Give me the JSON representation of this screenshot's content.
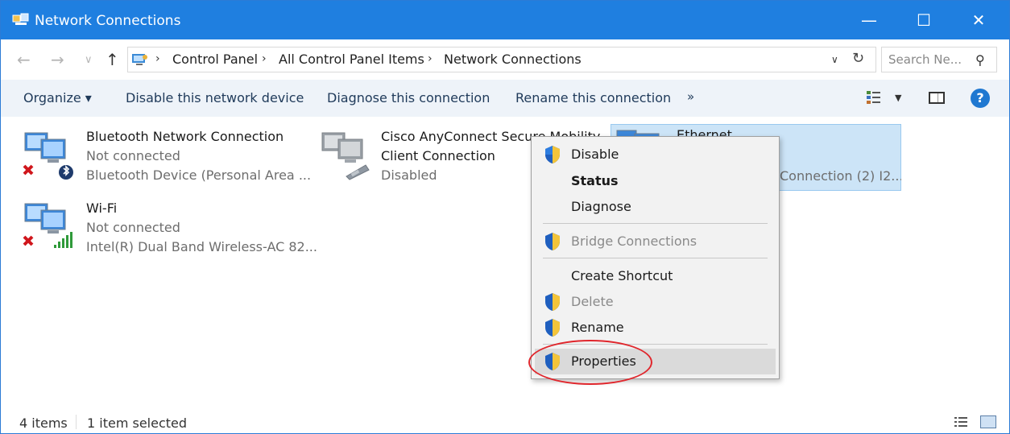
{
  "window": {
    "title": "Network Connections",
    "controls": {
      "minimize": "—",
      "maximize": "☐",
      "close": "✕"
    }
  },
  "address": {
    "back_icon": "←",
    "forward_icon": "→",
    "history_icon": "∨",
    "up_icon": "↑",
    "separator": "›",
    "breadcrumbs": [
      "Control Panel",
      "All Control Panel Items",
      "Network Connections"
    ],
    "dropdown_icon": "∨",
    "refresh_icon": "↻",
    "search_placeholder": "Search Ne...",
    "search_icon": "⚲"
  },
  "toolbar": {
    "organize": "Organize ▾",
    "disable": "Disable this network device",
    "diagnose": "Diagnose this connection",
    "rename": "Rename this connection",
    "more": "»",
    "view_dropdown": "▼",
    "help": "?"
  },
  "items": [
    {
      "name": "Bluetooth Network Connection",
      "status": "Not connected",
      "device": "Bluetooth Device (Personal Area ..."
    },
    {
      "name": "Cisco AnyConnect Secure Mobility",
      "name2": "Client Connection",
      "status": "Disabled"
    },
    {
      "name": "Ethernet",
      "device": "Connection (2) I2..."
    },
    {
      "name": "Wi-Fi",
      "status": "Not connected",
      "device": "Intel(R) Dual Band Wireless-AC 82..."
    }
  ],
  "context_menu": {
    "disable": "Disable",
    "status": "Status",
    "diagnose": "Diagnose",
    "bridge": "Bridge Connections",
    "shortcut": "Create Shortcut",
    "delete": "Delete",
    "rename": "Rename",
    "properties": "Properties"
  },
  "status_bar": {
    "count": "4 items",
    "selected": "1 item selected"
  },
  "colors": {
    "titlebar": "#1f7fe0",
    "selection": "#cce4f7",
    "annotation_circle": "#e0262c"
  }
}
